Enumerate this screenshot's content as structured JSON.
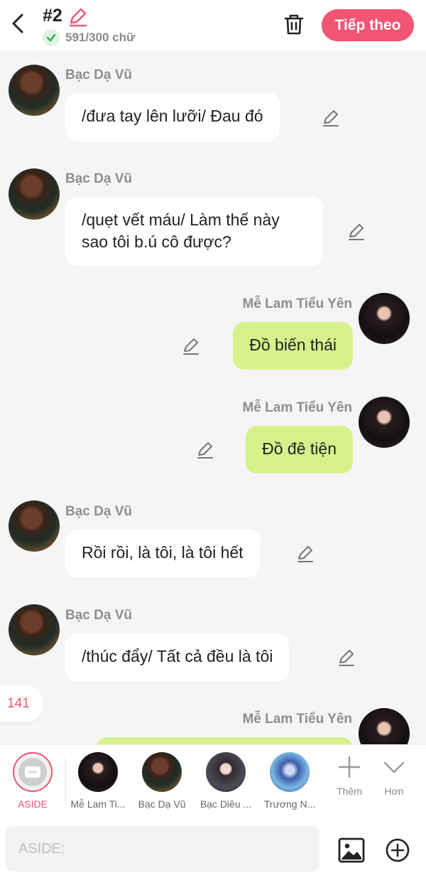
{
  "header": {
    "chapter": "#2",
    "word_count": "591/300 chữ",
    "next_label": "Tiếp theo"
  },
  "messages": [
    {
      "sender": "Bạc Dạ Vũ",
      "side": "left",
      "lines": [
        "/đưa tay lên lưỡi/ Đau đó"
      ]
    },
    {
      "sender": "Bạc Dạ Vũ",
      "side": "left",
      "lines": [
        "/quẹt vết máu/ Làm thế này",
        "sao tôi b.ú cô được?"
      ]
    },
    {
      "sender": "Mễ Lam Tiểu Yên",
      "side": "right",
      "lines": [
        "Đồ biến thái"
      ]
    },
    {
      "sender": "Mễ Lam Tiểu Yên",
      "side": "right",
      "lines": [
        "Đồ đê tiện"
      ]
    },
    {
      "sender": "Bạc Dạ Vũ",
      "side": "left",
      "lines": [
        "Rồi rồi, là tôi, là tôi hết"
      ]
    },
    {
      "sender": "Bạc Dạ Vũ",
      "side": "left",
      "lines": [
        "/thúc đẩy/ Tất cả đều là tôi"
      ]
    },
    {
      "sender": "Mễ Lam Tiểu Yên",
      "side": "right",
      "lines": [
        ""
      ]
    }
  ],
  "count_badge": "141",
  "characters": [
    {
      "name": "ASIDE",
      "type": "aside"
    },
    {
      "name": "Mễ Lam Ti...",
      "type": "me"
    },
    {
      "name": "Bạc Dạ Vũ",
      "type": "bac"
    },
    {
      "name": "Bạc Diêu ...",
      "type": "dieu"
    },
    {
      "name": "Trương N...",
      "type": "truong"
    }
  ],
  "tools": {
    "more_label": "Thêm",
    "expand_label": "Hơn"
  },
  "input": {
    "placeholder": "ASIDE:"
  },
  "colors": {
    "accent": "#f25473",
    "bubble_right": "#d5f28b",
    "bubble_left": "#ffffff"
  },
  "icons": [
    "back-arrow-icon",
    "pencil-icon",
    "check-icon",
    "trash-icon",
    "image-icon",
    "plus-circle-icon",
    "plus-icon",
    "chevron-down-icon"
  ]
}
